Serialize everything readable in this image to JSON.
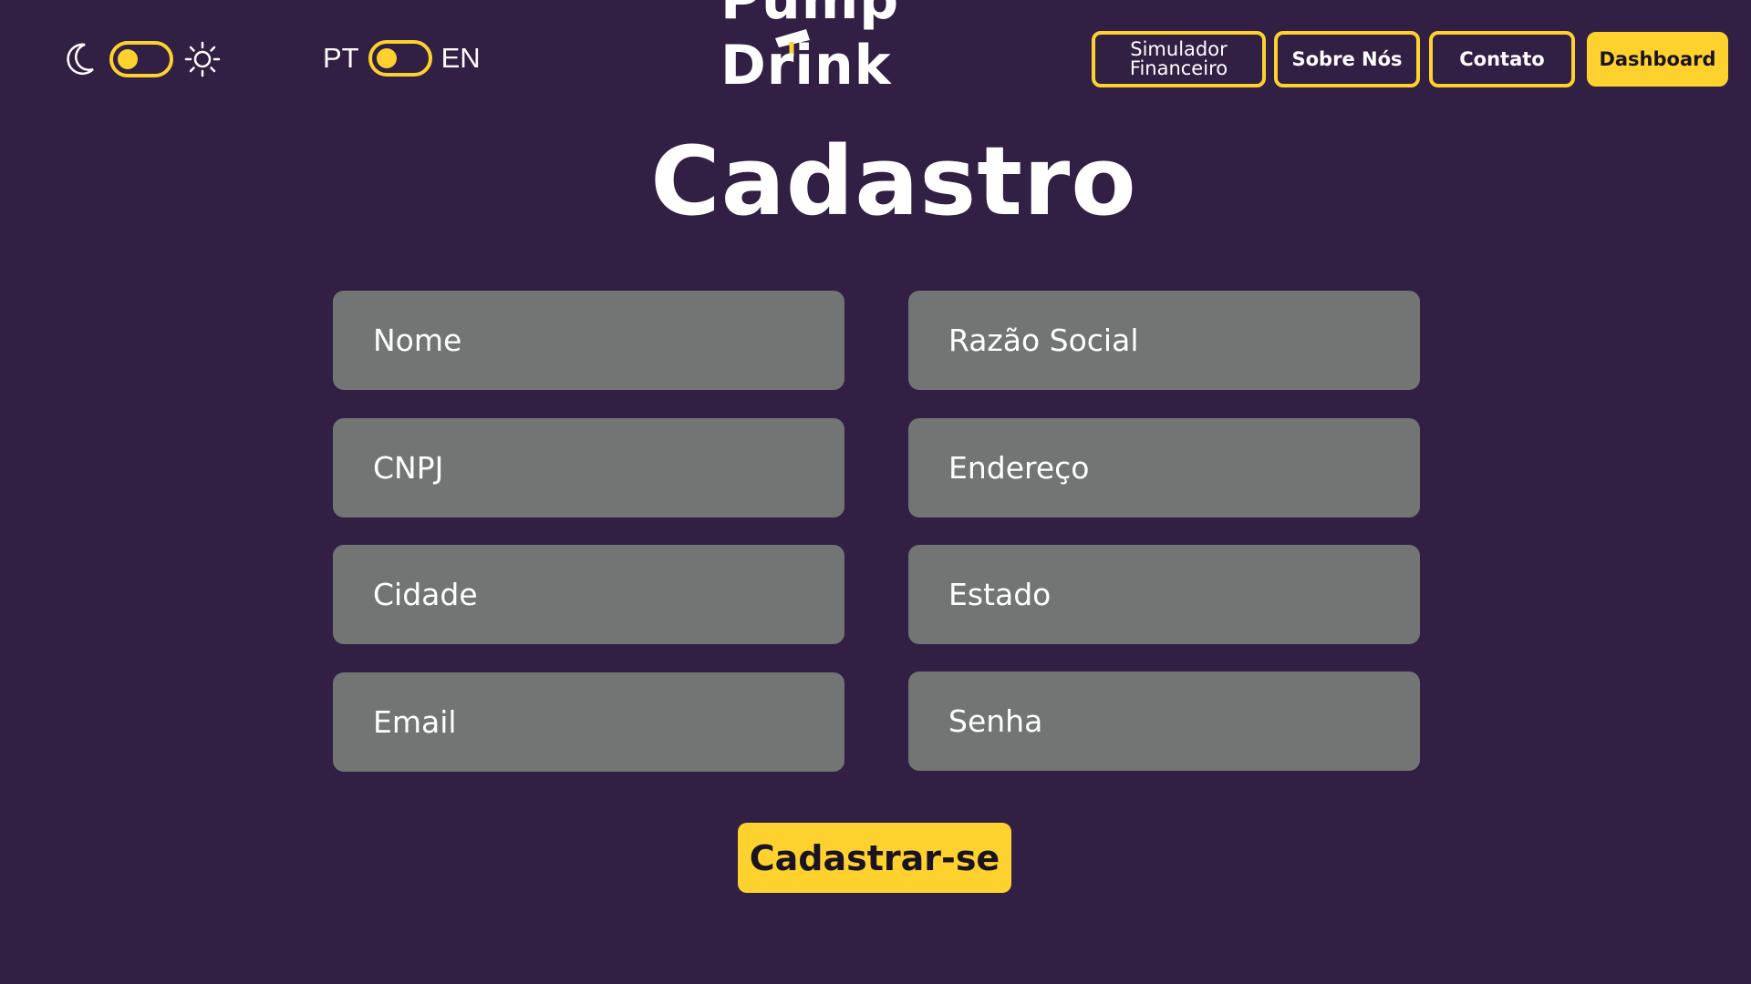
{
  "header": {
    "theme_toggle": {
      "mode": "dark",
      "moon_icon": "moon-icon",
      "sun_icon": "sun-icon"
    },
    "language_toggle": {
      "left_label": "PT",
      "right_label": "EN",
      "selected": "PT"
    },
    "logo": {
      "text": "Pump Drink"
    },
    "nav": {
      "simulador_line1": "Simulador",
      "simulador_line2": "Financeiro",
      "sobre": "Sobre Nós",
      "contato": "Contato",
      "dashboard": "Dashboard"
    }
  },
  "main": {
    "title": "Cadastro",
    "fields": {
      "nome": "Nome",
      "razao_social": "Razão Social",
      "cnpj": "CNPJ",
      "endereco": "Endereço",
      "cidade": "Cidade",
      "estado": "Estado",
      "email": "Email",
      "senha": "Senha"
    },
    "submit_label": "Cadastrar-se"
  },
  "colors": {
    "background": "#311f44",
    "accent": "#fdd22e",
    "field_bg": "#727573",
    "text": "#ffffff"
  }
}
